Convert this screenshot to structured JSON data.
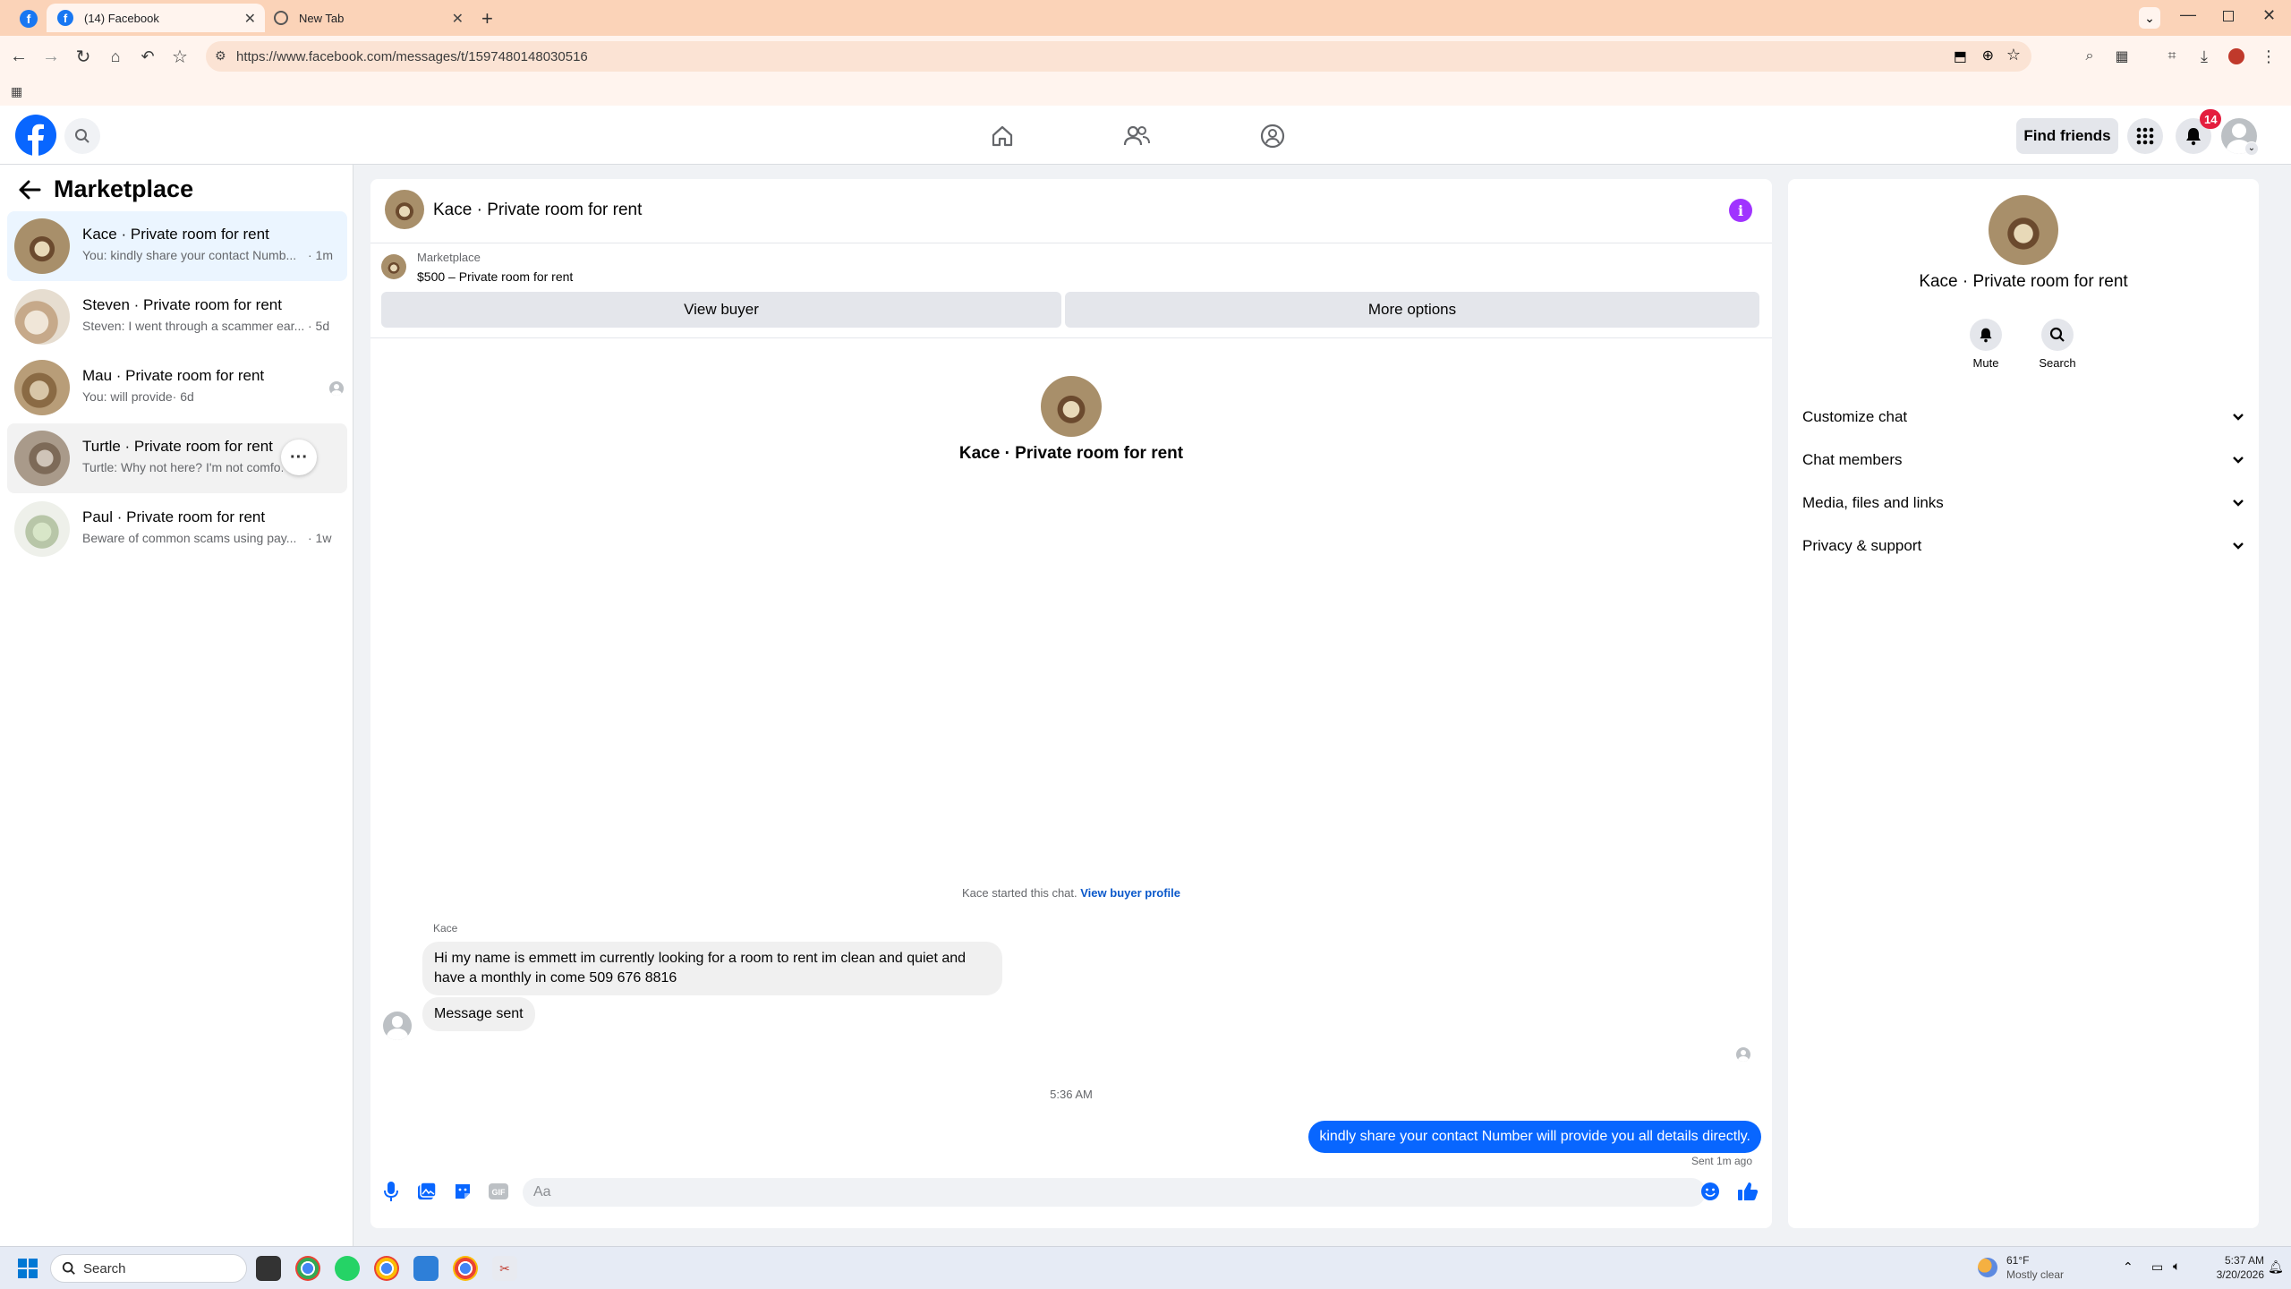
{
  "browser": {
    "tabs": [
      {
        "label": "(14) Facebook",
        "icon": "facebook-icon"
      },
      {
        "label": "New Tab",
        "icon": "globe-icon"
      }
    ],
    "url": "https://www.facebook.com/messages/t/1597480148030516"
  },
  "header": {
    "find_friends": "Find friends",
    "notification_count": "14"
  },
  "sidebar": {
    "title": "Marketplace",
    "conversations": [
      {
        "name": "Kace · Private room for rent",
        "preview": "You: kindly share your contact Numb...",
        "time": "· 1m"
      },
      {
        "name": "Steven · Private room for rent",
        "preview": "Steven: I went through a scammer ear...",
        "time": "· 5d"
      },
      {
        "name": "Mau · Private room for rent",
        "preview": "You: will provide",
        "time": "· 6d"
      },
      {
        "name": "Turtle · Private room for rent",
        "preview": "Turtle: Why not here? I'm not comfo...",
        "time": ""
      },
      {
        "name": "Paul · Private room for rent",
        "preview": "Beware of common scams using pay...",
        "time": "· 1w"
      }
    ]
  },
  "chat": {
    "title": "Kace · Private room for rent",
    "listing_source": "Marketplace",
    "listing_title": "$500 – Private room for rent",
    "view_buyer": "View buyer",
    "more_options": "More options",
    "intro_name": "Kace · Private room for rent",
    "started_text": "Kace started this chat.",
    "view_buyer_profile": "View buyer profile",
    "sender_name": "Kace",
    "incoming_1": "Hi my name is emmett im currently looking for a room to rent im clean and quiet and have a monthly in come 509 676 8816",
    "incoming_2": "Message sent",
    "timestamp": "5:36 AM",
    "outgoing": "kindly share your contact Number will provide you all details directly.",
    "sent_status": "Sent 1m ago",
    "composer_placeholder": "Aa"
  },
  "details": {
    "name": "Kace · Private room for rent",
    "mute": "Mute",
    "search": "Search",
    "sections": [
      "Customize chat",
      "Chat members",
      "Media, files and links",
      "Privacy & support"
    ]
  },
  "taskbar": {
    "search": "Search",
    "weather_temp": "61°F",
    "weather_desc": "Mostly clear",
    "time": "5:37 AM",
    "date": "3/20/2026"
  },
  "colors": {
    "brand": "#0866ff",
    "info_button": "#a033ff",
    "badge": "#e41e3f"
  }
}
